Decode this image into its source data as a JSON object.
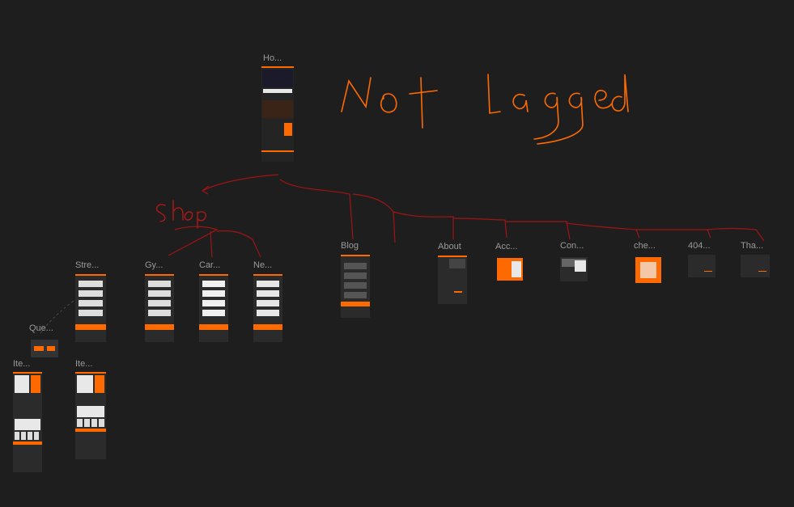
{
  "annotations": {
    "title": "Not lagged",
    "shop": "Shop"
  },
  "frames": [
    {
      "label": "Ho...",
      "name": "home"
    },
    {
      "label": "Blog",
      "name": "blog"
    },
    {
      "label": "About",
      "name": "about"
    },
    {
      "label": "Acc...",
      "name": "account"
    },
    {
      "label": "Con...",
      "name": "contact"
    },
    {
      "label": "che...",
      "name": "checkout"
    },
    {
      "label": "404...",
      "name": "not-found"
    },
    {
      "label": "Tha...",
      "name": "thanks"
    },
    {
      "label": "Stre...",
      "name": "streetwear"
    },
    {
      "label": "Gy...",
      "name": "gym"
    },
    {
      "label": "Car...",
      "name": "cardio"
    },
    {
      "label": "Ne...",
      "name": "new"
    },
    {
      "label": "Que...",
      "name": "question"
    },
    {
      "label": "Ite...",
      "name": "item-1"
    },
    {
      "label": "Ite...",
      "name": "item-2"
    }
  ],
  "colors": {
    "canvas": "#1e1e1e",
    "accent": "#ff6a00",
    "ink_red": "#b01818",
    "ink_orange": "#ff6a00"
  }
}
